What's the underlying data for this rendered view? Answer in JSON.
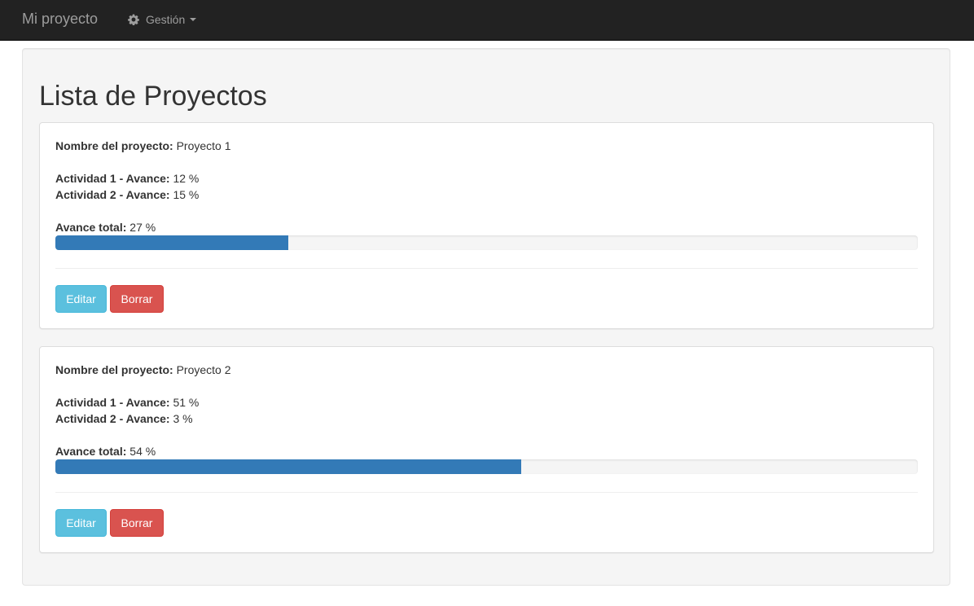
{
  "navbar": {
    "brand": "Mi proyecto",
    "menu_label": "Gestión",
    "menu_icon": "gear-icon",
    "background": "#222222"
  },
  "page": {
    "title": "Lista de Proyectos"
  },
  "labels": {
    "project_name": "Nombre del proyecto:",
    "total": "Avance total:",
    "edit": "Editar",
    "delete": "Borrar"
  },
  "projects": [
    {
      "name": "Proyecto 1",
      "activities": [
        {
          "label": "Actividad 1 - Avance:",
          "value": "12 %"
        },
        {
          "label": "Actividad 2 - Avance:",
          "value": "15 %"
        }
      ],
      "total": "27 %",
      "progress_percent": 27
    },
    {
      "name": "Proyecto 2",
      "activities": [
        {
          "label": "Actividad 1 - Avance:",
          "value": "51 %"
        },
        {
          "label": "Actividad 2 - Avance:",
          "value": "3 %"
        }
      ],
      "total": "54 %",
      "progress_percent": 54
    }
  ],
  "colors": {
    "progress": "#337ab7",
    "edit_button": "#5bc0de",
    "delete_button": "#d9534f"
  }
}
